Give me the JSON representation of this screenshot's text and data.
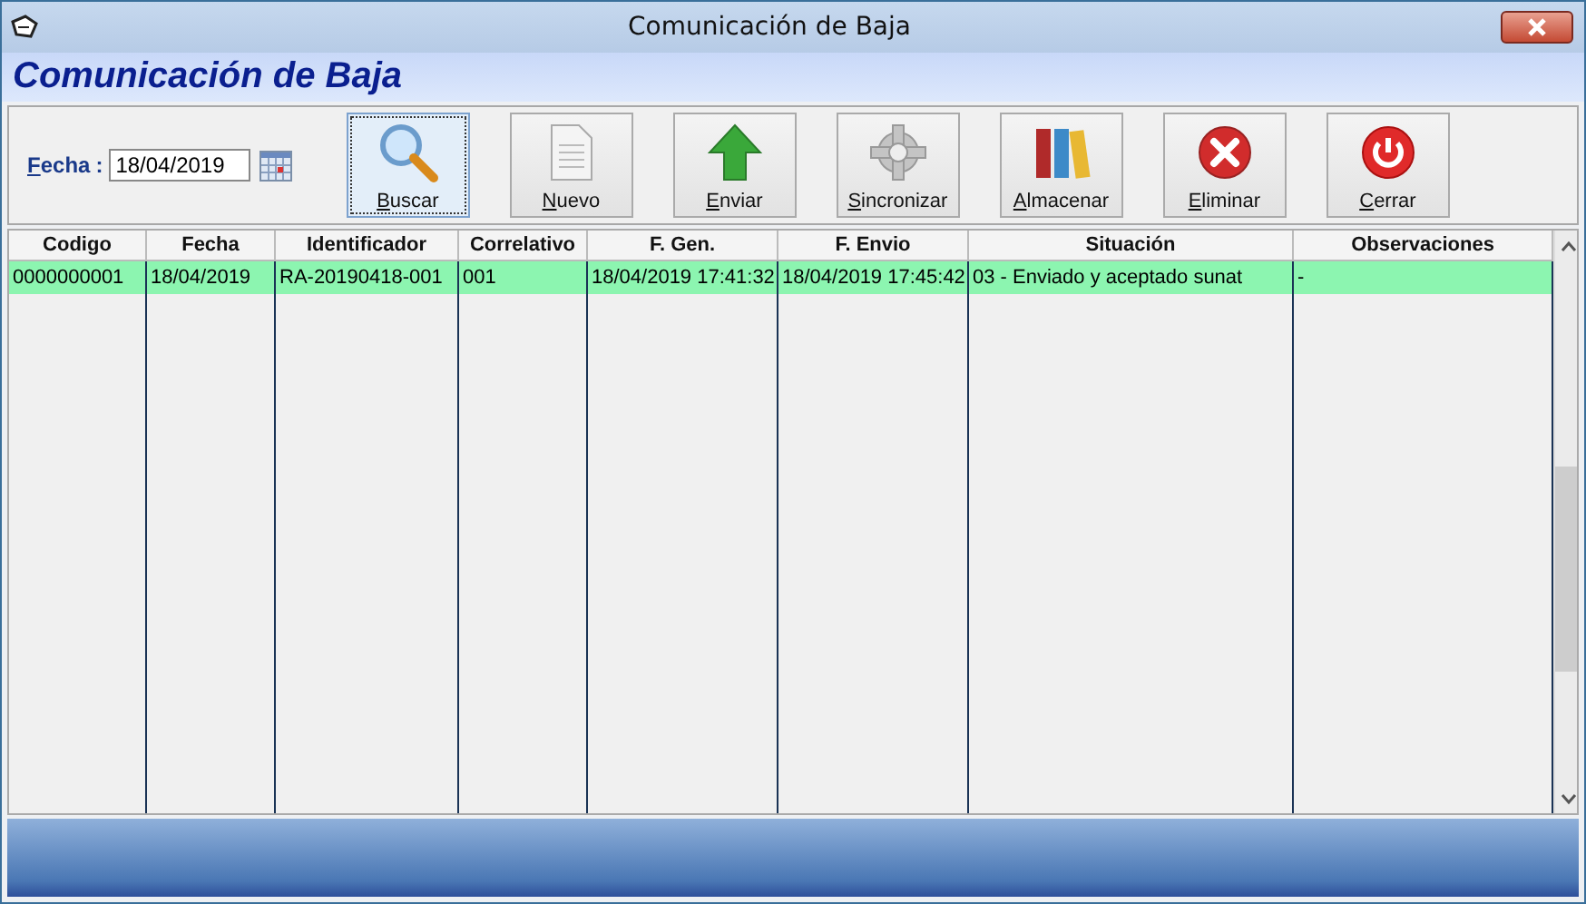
{
  "window": {
    "title": "Comunicación de Baja"
  },
  "header": {
    "title": "Comunicación de Baja"
  },
  "toolbar": {
    "date_label": "Fecha",
    "date_separator": ":",
    "date_value": "18/04/2019",
    "buttons": [
      {
        "label": "Buscar",
        "kind": "search",
        "focused": true
      },
      {
        "label": "Nuevo",
        "kind": "document",
        "focused": false
      },
      {
        "label": "Enviar",
        "kind": "upload",
        "focused": false
      },
      {
        "label": "Sincronizar",
        "kind": "gear",
        "focused": false
      },
      {
        "label": "Almacenar",
        "kind": "binders",
        "focused": false
      },
      {
        "label": "Eliminar",
        "kind": "delete",
        "focused": false
      },
      {
        "label": "Cerrar",
        "kind": "power",
        "focused": false
      }
    ]
  },
  "table": {
    "columns": [
      "Codigo",
      "Fecha",
      "Identificador",
      "Correlativo",
      "F. Gen.",
      "F. Envio",
      "Situación",
      "Observaciones"
    ],
    "rows": [
      {
        "selected": true,
        "cells": [
          "0000000001",
          "18/04/2019",
          "RA-20190418-001",
          "001",
          "18/04/2019 17:41:32",
          "18/04/2019 17:45:42",
          "03 - Enviado y aceptado sunat",
          "-"
        ]
      }
    ]
  }
}
